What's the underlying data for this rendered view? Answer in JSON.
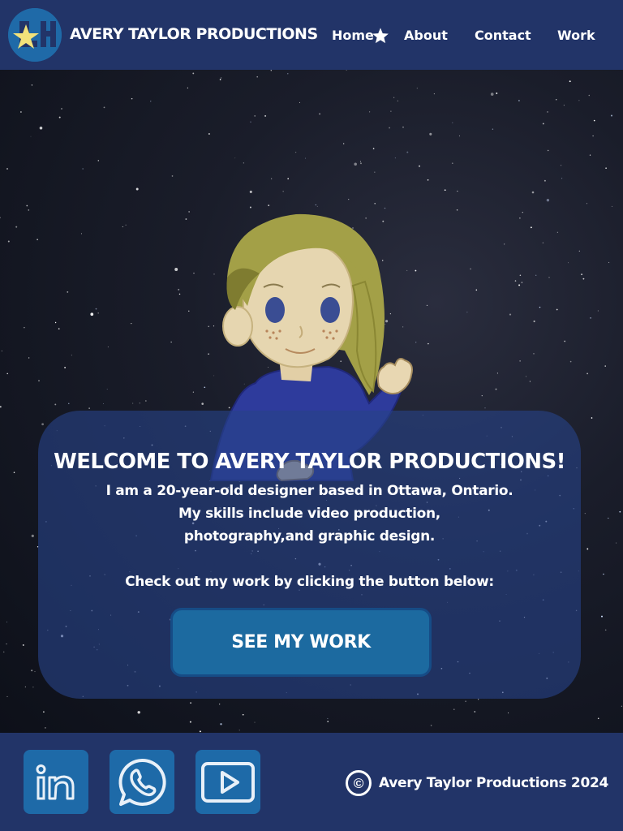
{
  "header": {
    "brand": "AVERY TAYLOR PRODUCTIONS",
    "nav": [
      {
        "label": "Home"
      },
      {
        "label": "About"
      },
      {
        "label": "Contact"
      },
      {
        "label": "Work"
      }
    ]
  },
  "hero": {
    "title": "WELCOME TO AVERY TAYLOR PRODUCTIONS!",
    "intro_lines": [
      "I am a 20-year-old designer based in Ottawa, Ontario.",
      "My skills include video production,",
      "photography,and graphic design."
    ],
    "prompt": "Check out my work by clicking the button below:",
    "cta_label": "SEE MY WORK"
  },
  "footer": {
    "social": [
      {
        "icon": "linkedin-icon"
      },
      {
        "icon": "whatsapp-icon"
      },
      {
        "icon": "youtube-icon"
      }
    ],
    "copyright_symbol": "©",
    "copyright_text": "Avery Taylor Productions 2024"
  },
  "colors": {
    "nav_bg": "#223468",
    "accent_blue": "#1e6aa8",
    "card_bg": "rgba(38,66,136,0.62)"
  }
}
